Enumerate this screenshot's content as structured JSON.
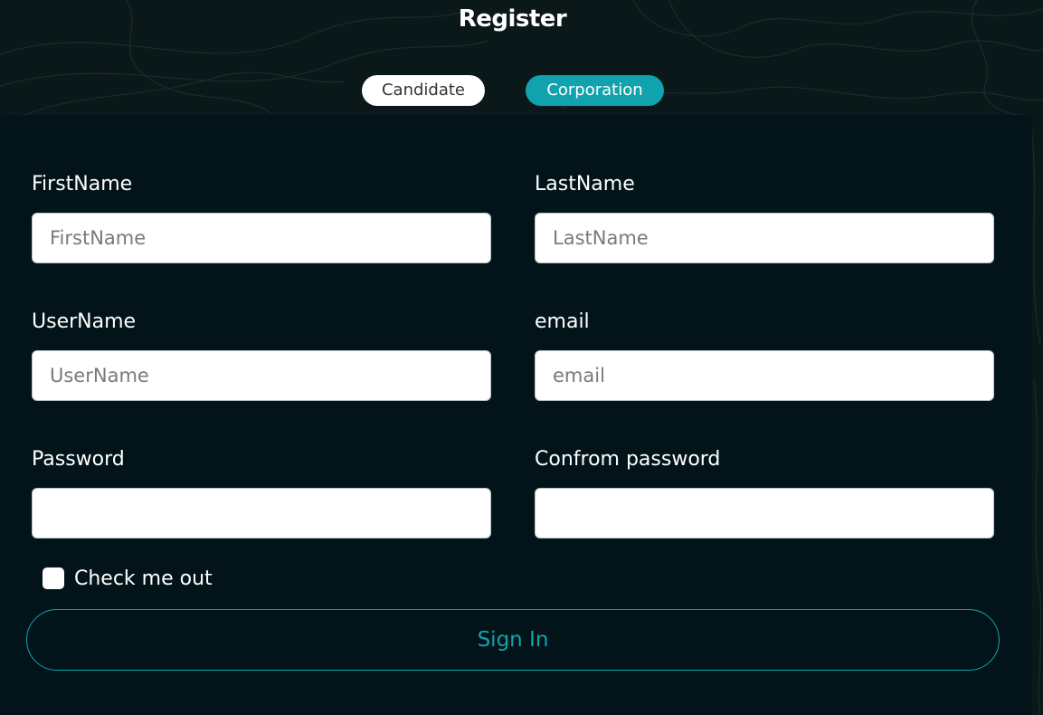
{
  "page": {
    "title": "Register"
  },
  "tabs": {
    "candidate": "Candidate",
    "corporation": "Corporation"
  },
  "form": {
    "first_name": {
      "label": "FirstName",
      "placeholder": "FirstName",
      "value": ""
    },
    "last_name": {
      "label": "LastName",
      "placeholder": "LastName",
      "value": ""
    },
    "user_name": {
      "label": "UserName",
      "placeholder": "UserName",
      "value": ""
    },
    "email": {
      "label": "email",
      "placeholder": "email",
      "value": ""
    },
    "password": {
      "label": "Password",
      "placeholder": "",
      "value": ""
    },
    "confirm_password": {
      "label": "Confrom password",
      "placeholder": "",
      "value": ""
    },
    "check_label": "Check me out",
    "checked": false,
    "submit_label": "Sign In"
  },
  "colors": {
    "background": "#0b1819",
    "card": "#02141a",
    "accent": "#10a3ad",
    "text": "#ffffff"
  }
}
